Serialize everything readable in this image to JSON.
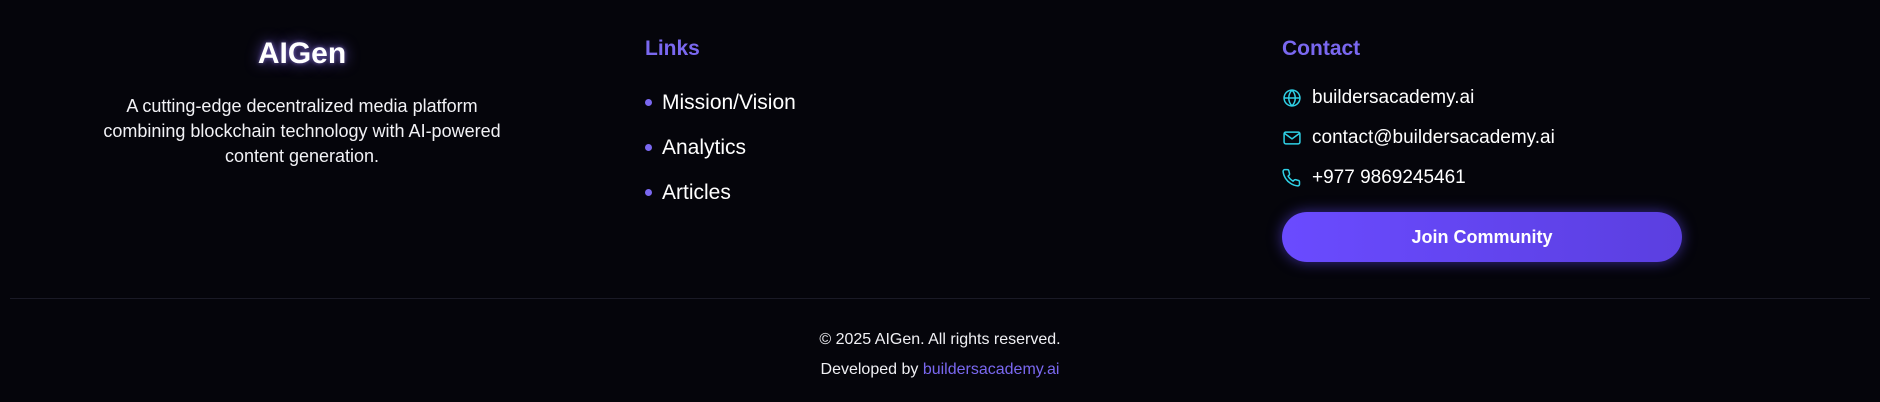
{
  "brand": {
    "name": "AIGen",
    "description": "A cutting-edge decentralized media platform combining blockchain technology with AI-powered content generation."
  },
  "links": {
    "heading": "Links",
    "items": [
      {
        "label": "Mission/Vision"
      },
      {
        "label": "Analytics"
      },
      {
        "label": "Articles"
      }
    ]
  },
  "contact": {
    "heading": "Contact",
    "website": {
      "icon": "globe-icon",
      "text": "buildersacademy.ai"
    },
    "email": {
      "icon": "mail-icon",
      "text": "contact@buildersacademy.ai"
    },
    "phone": {
      "icon": "phone-icon",
      "text": "+977 9869245461"
    },
    "join_label": "Join Community"
  },
  "bottom": {
    "copyright": "© 2025 AIGen. All rights reserved.",
    "developed_prefix": "Developed by ",
    "developed_link": "buildersacademy.ai"
  },
  "colors": {
    "background": "#05050b",
    "accent": "#7a68f0",
    "icon_cyan": "#2fd1e6",
    "button": "#6a4bff"
  }
}
